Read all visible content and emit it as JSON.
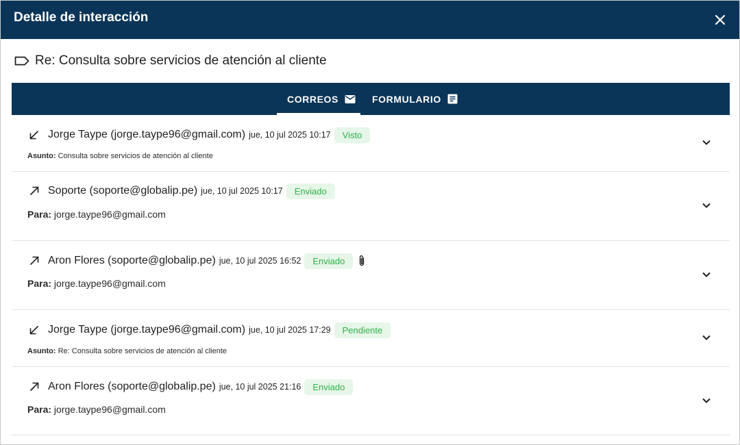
{
  "dialog": {
    "title": "Detalle de interacción",
    "close_icon": "close-icon"
  },
  "subject": {
    "icon": "label-tag-icon",
    "text": "Re: Consulta sobre servicios de atención al cliente"
  },
  "tabs": [
    {
      "label": "CORREOS",
      "icon": "mail-icon",
      "active": true
    },
    {
      "label": "FORMULARIO",
      "icon": "form-icon",
      "active": false
    }
  ],
  "labels": {
    "asunto": "Asunto:",
    "para": "Para:"
  },
  "emails": [
    {
      "direction": "incoming",
      "direction_icon": "arrow-incoming-icon",
      "sender": "Jorge Taype (jorge.taype96@gmail.com)",
      "date": "jue, 10 jul 2025 10:17",
      "status": "Visto",
      "attachment": false,
      "detail_label": "Asunto:",
      "detail_value": "Consulta sobre servicios de atención al cliente"
    },
    {
      "direction": "outgoing",
      "direction_icon": "arrow-outgoing-icon",
      "sender": "Soporte (soporte@globalip.pe)",
      "date": "jue, 10 jul 2025 10:17",
      "status": "Enviado",
      "attachment": false,
      "detail_label": "Para:",
      "detail_value": "jorge.taype96@gmail.com"
    },
    {
      "direction": "outgoing",
      "direction_icon": "arrow-outgoing-icon",
      "sender": "Aron Flores (soporte@globalip.pe)",
      "date": "jue, 10 jul 2025 16:52",
      "status": "Enviado",
      "attachment": true,
      "detail_label": "Para:",
      "detail_value": "jorge.taype96@gmail.com"
    },
    {
      "direction": "incoming",
      "direction_icon": "arrow-incoming-icon",
      "sender": "Jorge Taype (jorge.taype96@gmail.com)",
      "date": "jue, 10 jul 2025 17:29",
      "status": "Pendiente",
      "attachment": false,
      "detail_label": "Asunto:",
      "detail_value": "Re: Consulta sobre servicios de atención al cliente"
    },
    {
      "direction": "outgoing",
      "direction_icon": "arrow-outgoing-icon",
      "sender": "Aron Flores (soporte@globalip.pe)",
      "date": "jue, 10 jul 2025 21:16",
      "status": "Enviado",
      "attachment": false,
      "detail_label": "Para:",
      "detail_value": "jorge.taype96@gmail.com"
    }
  ],
  "colors": {
    "header_bg": "#0b3558",
    "status_text": "#2eb24a",
    "status_bg": "#e6f6e8"
  }
}
